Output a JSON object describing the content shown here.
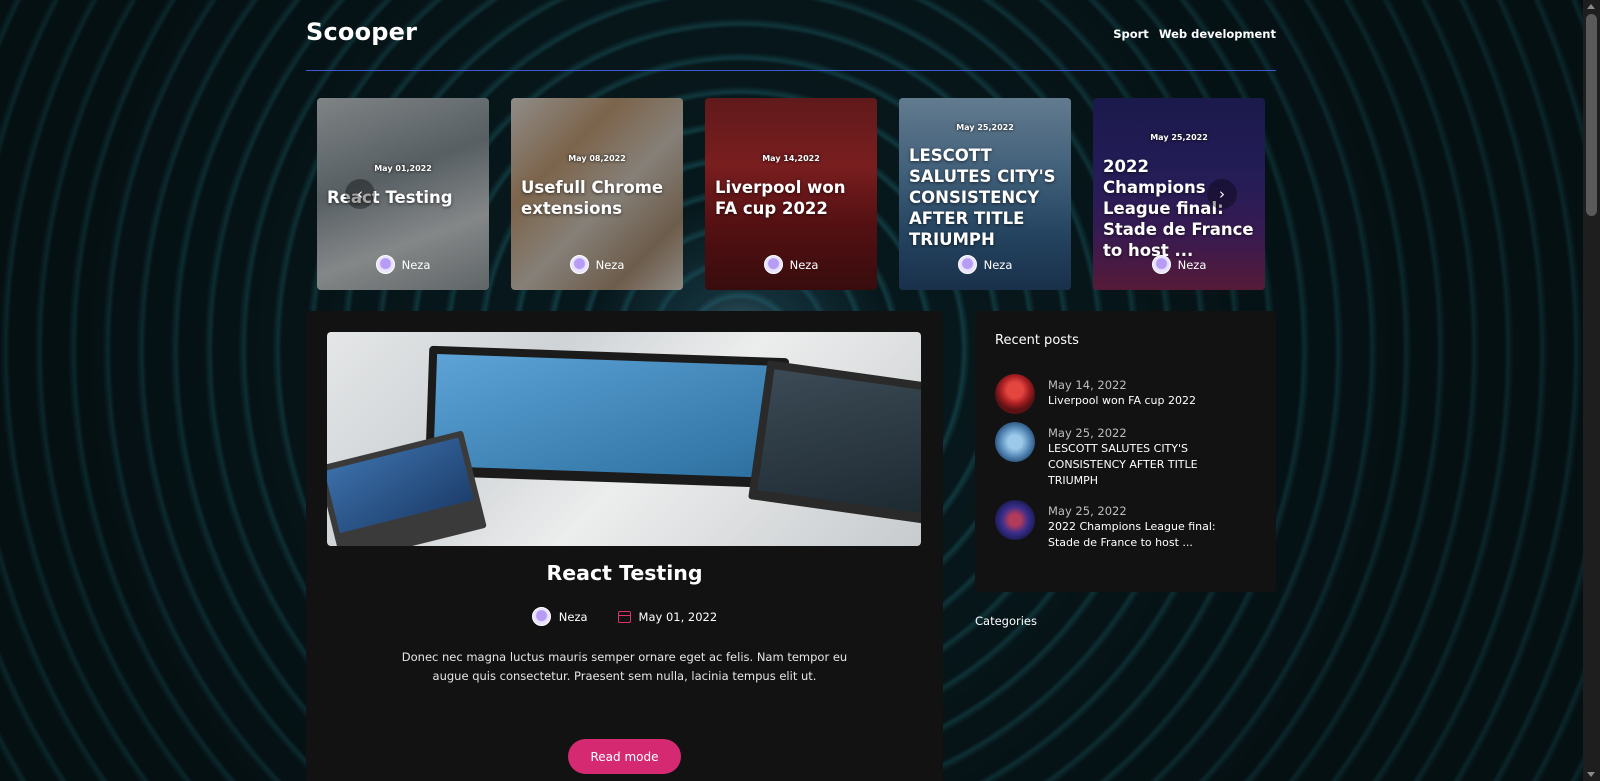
{
  "header": {
    "logo": "Scooper",
    "nav": [
      "Sport",
      "Web development"
    ]
  },
  "slider": {
    "cards": [
      {
        "date": "May 01,2022",
        "title": "React Testing",
        "author": "Neza"
      },
      {
        "date": "May 08,2022",
        "title": "Usefull Chrome extensions",
        "author": "Neza"
      },
      {
        "date": "May 14,2022",
        "title": "Liverpool won FA cup 2022",
        "author": "Neza"
      },
      {
        "date": "May 25,2022",
        "title": "LESCOTT SALUTES CITY'S CONSISTENCY AFTER TITLE TRIUMPH",
        "author": "Neza"
      },
      {
        "date": "May 25,2022",
        "title": "2022 Champions League final: Stade de France to host ...",
        "author": "Neza"
      }
    ],
    "prev_icon": "chevron-left-icon",
    "next_icon": "chevron-right-icon"
  },
  "main_post": {
    "title": "React Testing",
    "author": "Neza",
    "date": "May 01, 2022",
    "excerpt": "Donec nec magna luctus mauris semper ornare eget ac felis. Nam tempor eu augue quis consectetur. Praesent sem nulla, lacinia tempus elit ut.",
    "button_label": "Read mode"
  },
  "sidebar": {
    "recent_title": "Recent posts",
    "recent": [
      {
        "date": "May 14, 2022",
        "title": "Liverpool won FA cup 2022"
      },
      {
        "date": "May 25, 2022",
        "title": "LESCOTT SALUTES CITY'S CONSISTENCY AFTER TITLE TRIUMPH"
      },
      {
        "date": "May 25, 2022",
        "title": "2022 Champions League final: Stade de France to host ..."
      }
    ],
    "categories_title": "Categories"
  },
  "colors": {
    "accent": "#d52a72",
    "header_rule": "#3b5bd6",
    "panel": "#121212"
  }
}
